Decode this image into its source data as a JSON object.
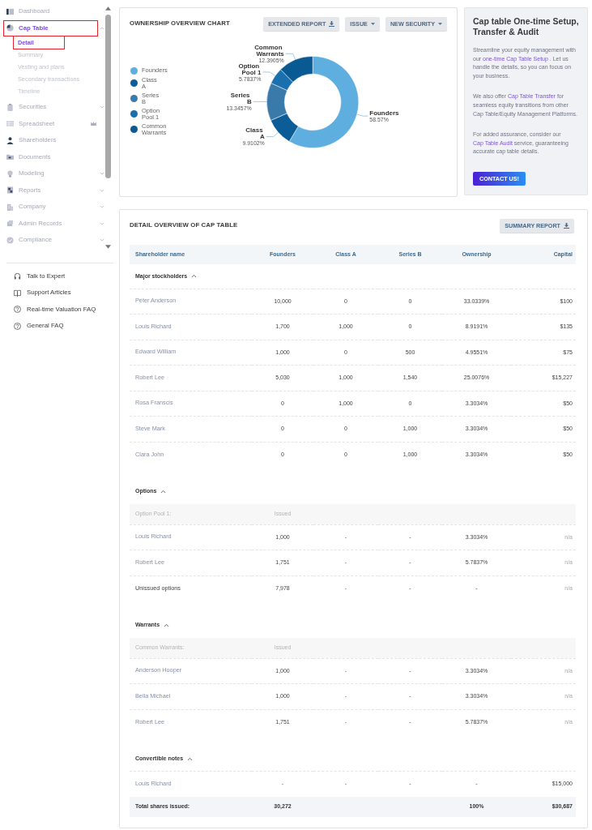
{
  "sidebar": {
    "items": [
      {
        "label": "Dashboard",
        "kind": "link",
        "selected": false,
        "highlighted": false,
        "premium": false
      },
      {
        "label": "Cap Table",
        "kind": "group",
        "selected": true,
        "highlighted": true,
        "premium": false,
        "expanded": true,
        "children": [
          {
            "label": "Detail",
            "selected": true,
            "highlighted": true
          },
          {
            "label": "Summary",
            "selected": false,
            "highlighted": false
          },
          {
            "label": "Vesting and plans",
            "selected": false,
            "highlighted": false
          },
          {
            "label": "Secondary transactions",
            "selected": false,
            "highlighted": false
          },
          {
            "label": "Timeline",
            "selected": false,
            "highlighted": false
          }
        ]
      },
      {
        "label": "Securities",
        "kind": "group",
        "selected": false,
        "highlighted": false,
        "premium": false,
        "expanded": false
      },
      {
        "label": "Spreadsheet",
        "kind": "link",
        "selected": false,
        "highlighted": false,
        "premium": true
      },
      {
        "label": "Shareholders",
        "kind": "link",
        "selected": false,
        "highlighted": false,
        "premium": false
      },
      {
        "label": "Documents",
        "kind": "link",
        "selected": false,
        "highlighted": false,
        "premium": false
      },
      {
        "label": "Modeling",
        "kind": "group",
        "selected": false,
        "highlighted": false,
        "premium": false,
        "expanded": false
      },
      {
        "label": "Reports",
        "kind": "group",
        "selected": false,
        "highlighted": false,
        "premium": false,
        "expanded": false
      },
      {
        "label": "Company",
        "kind": "group",
        "selected": false,
        "highlighted": false,
        "premium": false,
        "expanded": false
      },
      {
        "label": "Admin Records",
        "kind": "group",
        "selected": false,
        "highlighted": false,
        "premium": false,
        "expanded": false
      },
      {
        "label": "Compliance",
        "kind": "group",
        "selected": false,
        "highlighted": false,
        "premium": false,
        "expanded": false
      }
    ],
    "help_links": [
      "Talk to Expert",
      "Support Articles",
      "Real-time Valuation FAQ",
      "General FAQ"
    ]
  },
  "ownership_chart": {
    "title": "OWNERSHIP OVERVIEW CHART",
    "buttons": [
      {
        "label": "EXTENDED REPORT",
        "kind": "download"
      },
      {
        "label": "ISSUE",
        "kind": "dropdown"
      },
      {
        "label": "NEW SECURITY",
        "kind": "dropdown"
      }
    ],
    "legend": [
      {
        "label": "Founders",
        "color": "#5eaee0"
      },
      {
        "label": "Class A",
        "color": "#0b5c97"
      },
      {
        "label": "Series B",
        "color": "#3a7aaa"
      },
      {
        "label": "Option Pool 1",
        "color": "#1a6fae"
      },
      {
        "label": "Common Warrants",
        "color": "#095a93"
      }
    ],
    "chart_data": {
      "type": "donut",
      "categories": [
        "Founders",
        "Class A",
        "Series B",
        "Option Pool 1",
        "Common Warrants"
      ],
      "values": [
        58.57,
        9.9102,
        13.3457,
        5.7837,
        12.3905
      ],
      "value_labels": [
        "58.57%",
        "9.9102%",
        "13.3457%",
        "5.7837%",
        "12.3905%"
      ]
    }
  },
  "promo": {
    "title": "Cap table One-time Setup, Transfer & Audit",
    "paragraphs": [
      {
        "before": "Streamline your equity management with our ",
        "link": "one-time Cap Table Setup",
        "after": " . Let us handle the details, so you can focus on your business."
      },
      {
        "before": "We also offer ",
        "link": "Cap Table Transfer",
        "after": " for seamless equity transitions from other Cap Table/Equity Management Platforms."
      },
      {
        "before": "For added assurance, consider our ",
        "link": "Cap Table Audit",
        "after": " service, guaranteeing accurate cap table details."
      }
    ],
    "button": "CONTACT US!"
  },
  "cap_table": {
    "title": "DETAIL OVERVIEW OF CAP TABLE",
    "button": {
      "label": "SUMMARY REPORT",
      "kind": "download"
    },
    "columns": [
      "Shareholder name",
      "Founders",
      "Class A",
      "Series B",
      "Ownership",
      "Capital"
    ],
    "sections": [
      {
        "title": "Major stockholders",
        "expanded": true,
        "rows": [
          {
            "kind": "holder",
            "cells": [
              "Peter Anderson",
              "10,000",
              "0",
              "0",
              "33.0339%",
              "$100"
            ]
          },
          {
            "kind": "holder",
            "cells": [
              "Louis Richard",
              "1,700",
              "1,000",
              "0",
              "8.9191%",
              "$135"
            ]
          },
          {
            "kind": "holder",
            "cells": [
              "Edward William",
              "1,000",
              "0",
              "500",
              "4.9551%",
              "$75"
            ]
          },
          {
            "kind": "holder",
            "cells": [
              "Robert Lee",
              "5,030",
              "1,000",
              "1,540",
              "25.0076%",
              "$15,227"
            ]
          },
          {
            "kind": "holder",
            "cells": [
              "Rosa Franscis",
              "0",
              "1,000",
              "0",
              "3.3034%",
              "$50"
            ]
          },
          {
            "kind": "holder",
            "cells": [
              "Steve Mark",
              "0",
              "0",
              "1,000",
              "3.3034%",
              "$50"
            ]
          },
          {
            "kind": "holder",
            "cells": [
              "Clara John",
              "0",
              "0",
              "1,000",
              "3.3034%",
              "$50"
            ]
          }
        ]
      },
      {
        "title": "Options",
        "expanded": true,
        "subheader": {
          "label": "Option Pool 1:",
          "founders": "Issued"
        },
        "rows": [
          {
            "kind": "grant",
            "cells": [
              "Louis Richard",
              "1,000",
              "-",
              "-",
              "3.3034%",
              "n/a"
            ]
          },
          {
            "kind": "grant",
            "cells": [
              "Robert Lee",
              "1,751",
              "-",
              "-",
              "5.7837%",
              "n/a"
            ]
          },
          {
            "kind": "unissued",
            "cells": [
              "Unissued options",
              "7,978",
              "-",
              "-",
              "-",
              "n/a"
            ]
          }
        ]
      },
      {
        "title": "Warrants",
        "expanded": true,
        "subheader": {
          "label": "Common Warrants:",
          "founders": "Issued"
        },
        "rows": [
          {
            "kind": "grant",
            "cells": [
              "Anderson Hooper",
              "1,000",
              "-",
              "-",
              "3.3034%",
              "n/a"
            ]
          },
          {
            "kind": "grant",
            "cells": [
              "Bella Michael",
              "1,000",
              "-",
              "-",
              "3.3034%",
              "n/a"
            ]
          },
          {
            "kind": "grant",
            "cells": [
              "Robert Lee",
              "1,751",
              "-",
              "-",
              "5.7837%",
              "n/a"
            ]
          }
        ]
      },
      {
        "title": "Convertible notes",
        "expanded": true,
        "rows": [
          {
            "kind": "holder",
            "cells": [
              "Louis Richard",
              "-",
              "-",
              "-",
              "-",
              "$15,000"
            ]
          }
        ]
      }
    ],
    "total": {
      "label": "Total shares issued:",
      "founders": "30,272",
      "ownership": "100%",
      "capital": "$30,687"
    }
  }
}
